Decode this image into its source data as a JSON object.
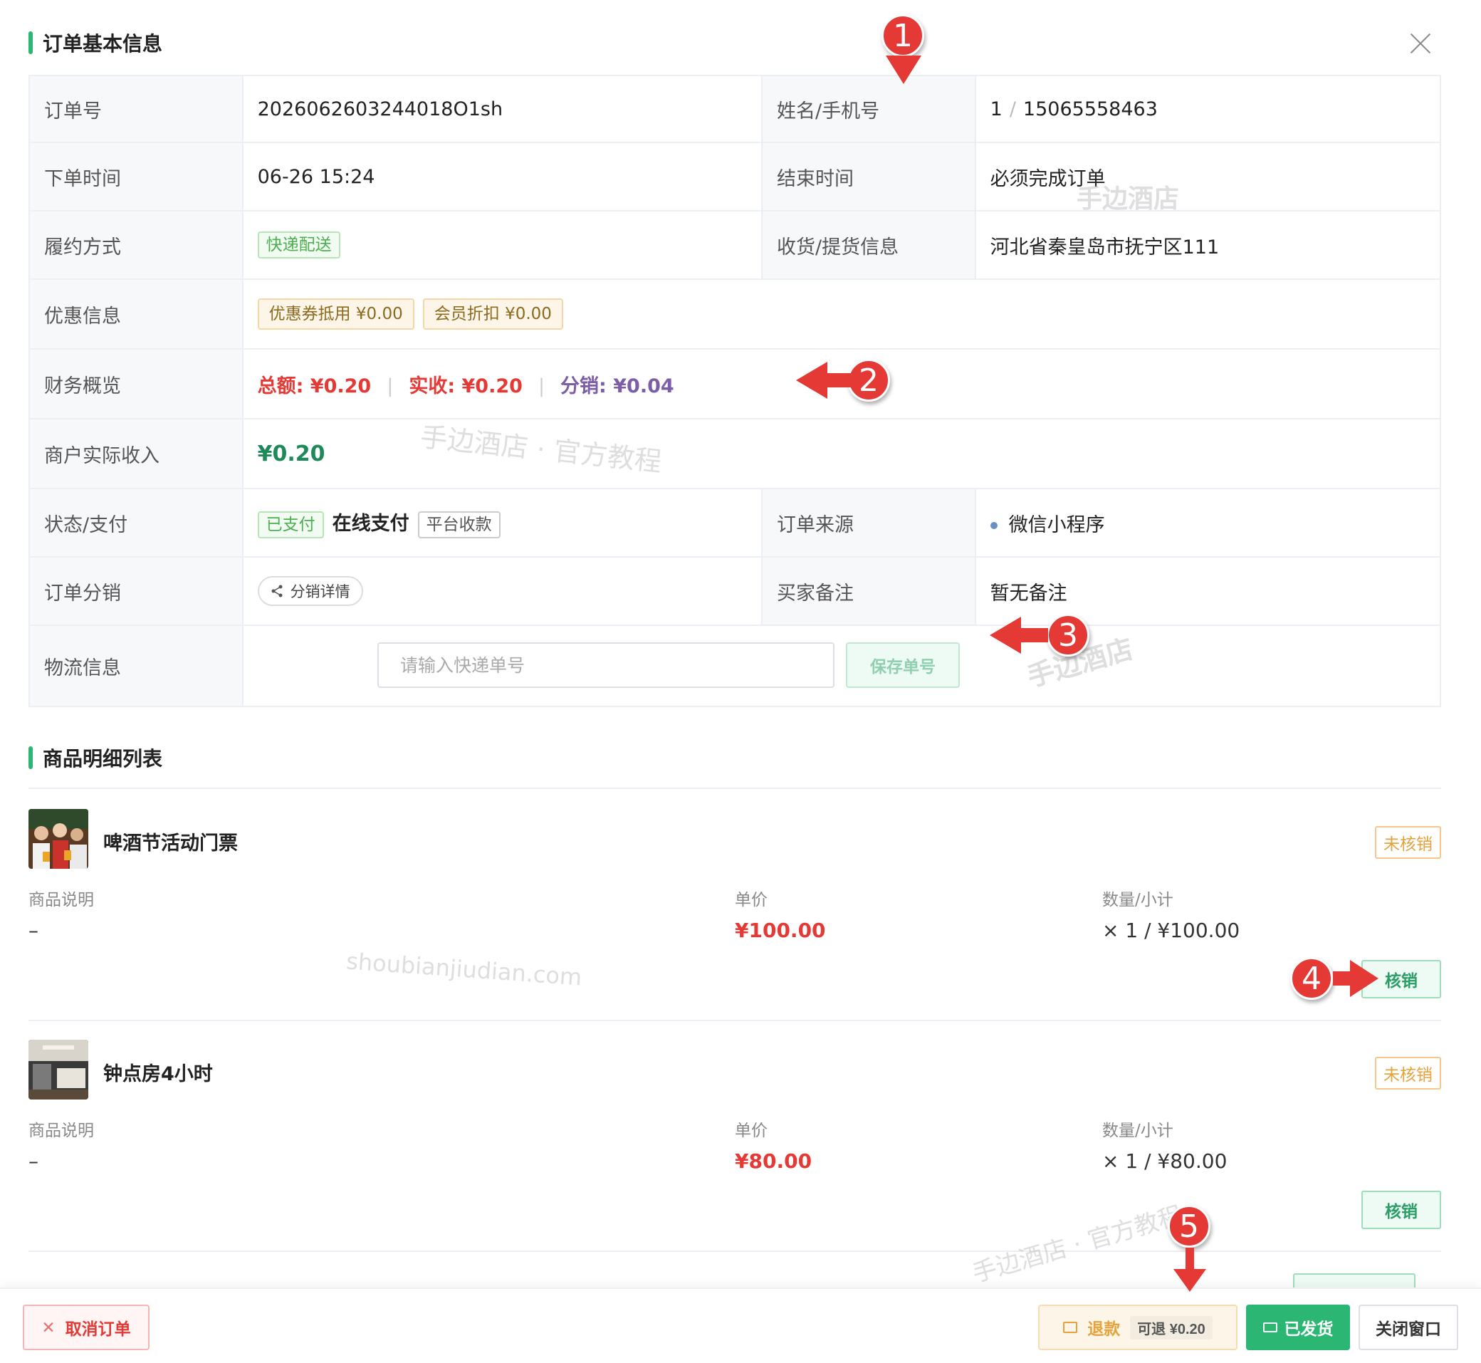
{
  "sections": {
    "basic_info_title": "订单基本信息",
    "items_title": "商品明细列表"
  },
  "order": {
    "order_no_label": "订单号",
    "order_no": "2026062603244018O1sh",
    "name_phone_label": "姓名/手机号",
    "customer_name": "1",
    "customer_sep": "/",
    "customer_phone": "15065558463",
    "order_time_label": "下单时间",
    "order_time": "06-26 15:24",
    "end_time_label": "结束时间",
    "end_time": "必须完成订单",
    "fulfillment_label": "履约方式",
    "fulfillment": "快递配送",
    "delivery_label": "收货/提货信息",
    "delivery_address": "河北省秦皇岛市抚宁区111",
    "discount_label": "优惠信息",
    "coupon": "优惠券抵用 ¥0.00",
    "member_discount": "会员折扣 ¥0.00",
    "finance_label": "财务概览",
    "total": "总额: ¥0.20",
    "received": "实收: ¥0.20",
    "distribution": "分销: ¥0.04",
    "finance_sep": "|",
    "merchant_income_label": "商户实际收入",
    "merchant_income": "¥0.20",
    "status_label": "状态/支付",
    "pay_status": "已支付",
    "pay_method": "在线支付",
    "collection": "平台收款",
    "source_label": "订单来源",
    "source": "微信小程序",
    "distribution_label": "订单分销",
    "distribution_detail": "分销详情",
    "remark_label": "买家备注",
    "remark": "暂无备注",
    "logistics_label": "物流信息",
    "tracking_placeholder": "请输入快递单号",
    "save_tracking": "保存单号"
  },
  "items": [
    {
      "name": "啤酒节活动门票",
      "status": "未核销",
      "desc_label": "商品说明",
      "desc": "–",
      "price_label": "单价",
      "price": "¥100.00",
      "qty_label": "数量/小计",
      "qty": "× 1 / ¥100.00",
      "redeem": "核销"
    },
    {
      "name": "钟点房4小时",
      "status": "未核销",
      "desc_label": "商品说明",
      "desc": "–",
      "price_label": "单价",
      "price": "¥80.00",
      "qty_label": "数量/小计",
      "qty": "× 1 / ¥80.00",
      "redeem": "核销"
    }
  ],
  "footer": {
    "cancel_order": "取消订单",
    "refund": "退款",
    "refundable": "可退 ¥0.20",
    "shipped": "已发货",
    "close_window": "关闭窗口"
  },
  "annotations": [
    "1",
    "2",
    "3",
    "4",
    "5"
  ],
  "watermarks": {
    "brand": "手边酒店",
    "tagline": "手边酒店 · 官方教程",
    "domain": "shoubianjiudian.com"
  },
  "colors": {
    "accent": "#2bb673",
    "price_red": "#e53935",
    "pending_orange": "#e6a23c",
    "distribution_purple": "#7b5ea7"
  },
  "icons": [
    "close-icon",
    "share-icon",
    "refund-icon",
    "truck-icon",
    "cancel-x-icon"
  ]
}
